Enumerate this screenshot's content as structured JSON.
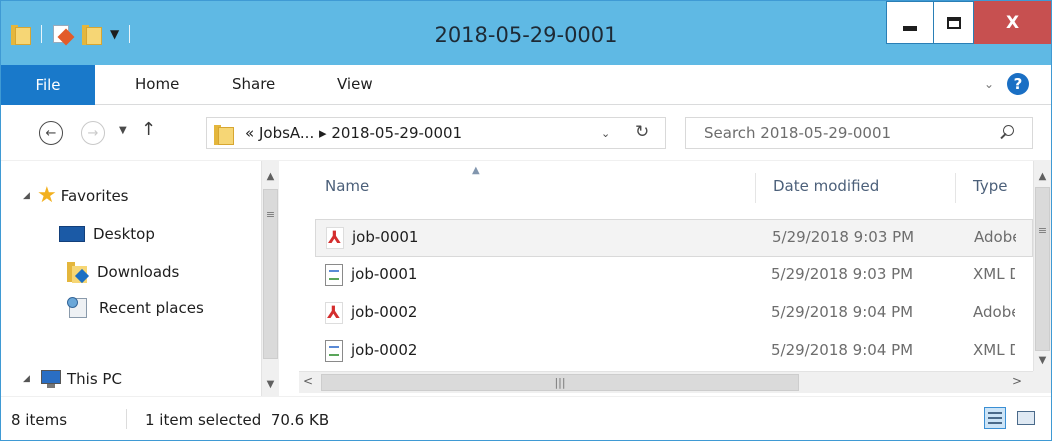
{
  "window": {
    "title": "2018-05-29-0001",
    "close_label": "X"
  },
  "ribbon": {
    "tabs": [
      {
        "label": "File"
      },
      {
        "label": "Home"
      },
      {
        "label": "Share"
      },
      {
        "label": "View"
      }
    ],
    "help_label": "?"
  },
  "address": {
    "prefix": "«",
    "crumbs": [
      "JobsA...",
      "2018-05-29-0001"
    ],
    "separator": "▸"
  },
  "search": {
    "placeholder": "Search 2018-05-29-0001"
  },
  "navigation": {
    "items": [
      {
        "label": "Favorites",
        "icon": "star-icon",
        "expanded": true
      },
      {
        "label": "Desktop",
        "icon": "desktop-icon"
      },
      {
        "label": "Downloads",
        "icon": "downloads-folder-icon"
      },
      {
        "label": "Recent places",
        "icon": "recent-places-icon"
      },
      {
        "label": "This PC",
        "icon": "computer-icon",
        "expanded": true
      }
    ]
  },
  "file_list": {
    "columns": [
      {
        "label": "Name",
        "sorted": "ascending"
      },
      {
        "label": "Date modified"
      },
      {
        "label": "Type"
      }
    ],
    "rows": [
      {
        "name": "job-0001",
        "date": "5/29/2018 9:03 PM",
        "type": "Adobe",
        "icon": "pdf-file-icon",
        "selected": true
      },
      {
        "name": "job-0001",
        "date": "5/29/2018 9:03 PM",
        "type": "XML Document",
        "icon": "xml-file-icon",
        "selected": false
      },
      {
        "name": "job-0002",
        "date": "5/29/2018 9:04 PM",
        "type": "Adobe",
        "icon": "pdf-file-icon",
        "selected": false
      },
      {
        "name": "job-0002",
        "date": "5/29/2018 9:04 PM",
        "type": "XML Document",
        "icon": "xml-file-icon",
        "selected": false
      }
    ]
  },
  "status": {
    "item_count": "8 items",
    "selection": "1 item selected  70.6 KB"
  },
  "colors": {
    "title_bar": "#5fb9e4",
    "file_tab": "#1979ca",
    "close_button": "#c75050",
    "pdf_icon": "#d42e2e"
  }
}
